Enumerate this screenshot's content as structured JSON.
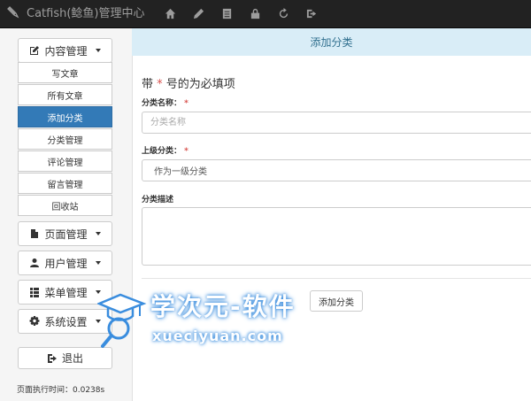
{
  "header": {
    "brand": "Catfish(鲶鱼)管理中心",
    "icons": [
      "home-icon",
      "pencil-icon",
      "list-alt-icon",
      "lock-icon",
      "refresh-icon",
      "logout-icon"
    ]
  },
  "sidebar": {
    "menus": [
      {
        "label": "内容管理",
        "icon": "edit-icon",
        "expanded": true
      },
      {
        "label": "页面管理",
        "icon": "file-icon"
      },
      {
        "label": "用户管理",
        "icon": "user-icon"
      },
      {
        "label": "菜单管理",
        "icon": "th-list-icon"
      },
      {
        "label": "系统设置",
        "icon": "cog-icon"
      }
    ],
    "content_items": [
      "写文章",
      "所有文章",
      "添加分类",
      "分类管理",
      "评论管理",
      "留言管理",
      "回收站"
    ],
    "active_item": "添加分类",
    "logout_label": "退出",
    "exec_time": "页面执行时间：0.0238s"
  },
  "main": {
    "panel_title": "添加分类",
    "form": {
      "title_prefix": "带",
      "required_mark": "*",
      "title_suffix": "号的为必填项",
      "name_label": "分类名称：",
      "name_placeholder": "分类名称",
      "parent_label": "上级分类：",
      "parent_selected": "作为一级分类",
      "desc_label": "分类描述",
      "submit_label": "添加分类"
    }
  },
  "watermark": {
    "title": "学次元-软件",
    "subtitle": "xueciyuan.com"
  },
  "colors": {
    "topbar": "#222222",
    "active": "#337ab7",
    "panel_heading": "#d9edf7",
    "required": "#d9534f"
  }
}
